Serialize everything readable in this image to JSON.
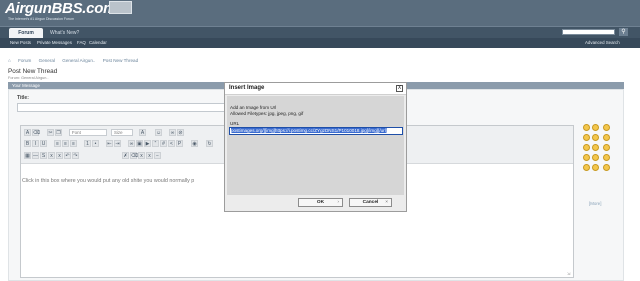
{
  "header": {
    "logo": "AirgunBBS.com",
    "tagline": "The Internet's #1 Airgun Discussion Forum",
    "tabs": [
      "Forum",
      "What's New?"
    ],
    "search_icon": "search-icon"
  },
  "subnav": {
    "items": [
      "New Posts",
      "Private Messages",
      "FAQ",
      "Calendar"
    ],
    "advanced_search": "Advanced Search"
  },
  "breadcrumb": {
    "home_icon": "home-icon",
    "items": [
      "Forum",
      "General",
      "General Airgun..",
      "Post New Thread"
    ]
  },
  "page": {
    "title": "Post New Thread",
    "subtitle": "Forum: General Airgun..",
    "section": "Your Message",
    "title_label": "Title:"
  },
  "editor": {
    "font_select": "Font",
    "size_select": "Size",
    "body_text": "Click in this box where you would put any old shite you would normally p",
    "more_smilies": "[More]"
  },
  "modal": {
    "title": "Insert Image",
    "close": "X",
    "desc_line1": "Add an Image from Url",
    "desc_line2": "Allowed Filetypes: jpg, jpeg, png, gif",
    "url_label": "URL",
    "url_value": "postimages.org/][img]https://i.postimg.cc/ZYgzDNS1/P1010018.jpg[/img][/url]",
    "ok": "OK",
    "cancel": "Cancel"
  }
}
